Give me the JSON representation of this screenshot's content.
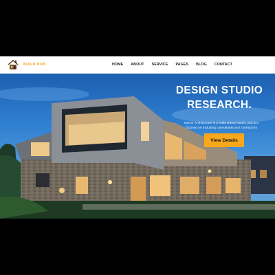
{
  "nav": {
    "brand": "BUILD HUB",
    "items": [
      "HOME",
      "ABOUT",
      "SERVICE",
      "PAGES",
      "BLOG",
      "CONTACT"
    ]
  },
  "hero": {
    "title_line1": "DESIGN STUDIO",
    "title_line2": "RESEARCH.",
    "text_line1": "Interor Architecture is a India Based studio practice",
    "text_line2": "focused on including consultants and contractors",
    "button": "View Details"
  },
  "colors": {
    "accent": "#f9a81b",
    "sky": "#2f7fd0"
  },
  "icons": {
    "logo": "house-logo-icon"
  }
}
